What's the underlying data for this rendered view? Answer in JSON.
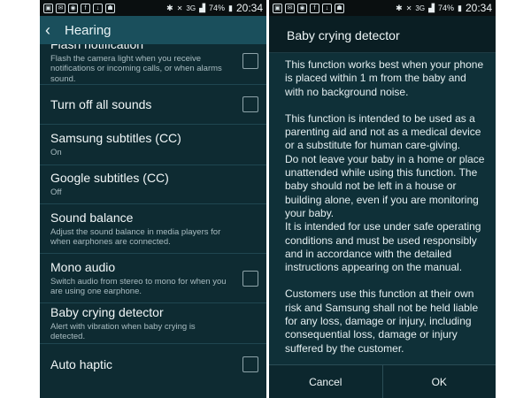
{
  "status_bar": {
    "icons": [
      "gallery-icon",
      "email-icon",
      "chrome-icon",
      "facebook-icon",
      "download-icon",
      "android-icon"
    ],
    "network": "3G",
    "battery": "74%",
    "time": "20:34"
  },
  "settings": {
    "title": "Hearing",
    "items": [
      {
        "title": "Flash notification",
        "subtitle": "Flash the camera light when you receive notifications or incoming calls, or when alarms sound.",
        "has_checkbox": true,
        "checked": false
      },
      {
        "title": "Turn off all sounds",
        "subtitle": "",
        "has_checkbox": true,
        "checked": false
      },
      {
        "title": "Samsung subtitles (CC)",
        "subtitle": "On",
        "has_checkbox": false
      },
      {
        "title": "Google subtitles (CC)",
        "subtitle": "Off",
        "has_checkbox": false
      },
      {
        "title": "Sound balance",
        "subtitle": "Adjust the sound balance in media players for when earphones are connected.",
        "has_checkbox": false
      },
      {
        "title": "Mono audio",
        "subtitle": "Switch audio from stereo to mono for when you are using one earphone.",
        "has_checkbox": true,
        "checked": false
      },
      {
        "title": "Baby crying detector",
        "subtitle": "Alert with vibration when baby crying is detected.",
        "has_checkbox": false
      },
      {
        "title": "Auto haptic",
        "subtitle": "",
        "has_checkbox": true,
        "checked": false
      }
    ]
  },
  "dialog": {
    "title": "Baby crying detector",
    "paragraphs": [
      "This function works best when your phone is placed within 1 m from the baby and with no background noise.",
      "This function is intended to be used as a parenting aid and not as a medical device or a substitute for human care-giving.",
      "Do not leave your baby in a home or place unattended while using this function. The baby should not be left in a house or building alone, even if you are monitoring your baby.",
      "It is intended for use under safe operating conditions and must be used responsibly and in accordance with the detailed instructions appearing on the manual.",
      "Customers use this function at their own risk and Samsung shall not be held liable for any loss, damage or injury, including consequential loss, damage or injury suffered by the customer."
    ],
    "cancel_label": "Cancel",
    "ok_label": "OK"
  }
}
